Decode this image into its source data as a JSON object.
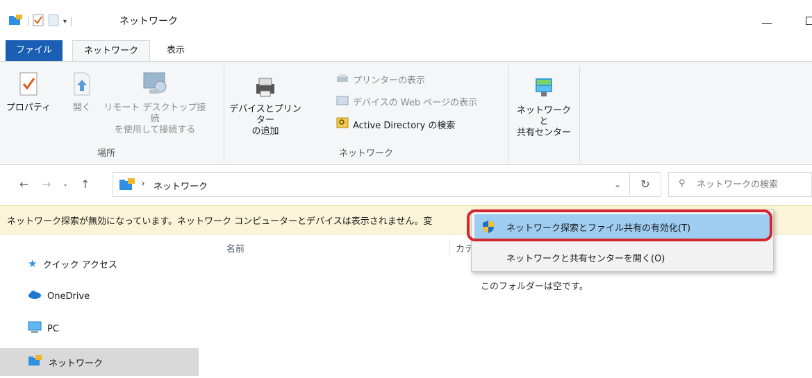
{
  "window": {
    "title": "ネットワーク"
  },
  "ribbon_tabs": {
    "file": "ファイル",
    "network": "ネットワーク",
    "view": "表示"
  },
  "ribbon": {
    "location_group": {
      "label": "場所",
      "properties": "プロパティ",
      "open": "開く",
      "remote_desktop_line1": "リモート デスクトップ接続",
      "remote_desktop_line2": "を使用して接続する"
    },
    "network_group": {
      "label": "ネットワーク",
      "add_devices_line1": "デバイスとプリンター",
      "add_devices_line2": "の追加",
      "show_printers": "プリンターの表示",
      "show_device_webpage": "デバイスの Web ページの表示",
      "search_ad": "Active Directory の検索"
    },
    "sharing_center_line1": "ネットワークと",
    "sharing_center_line2": "共有センター"
  },
  "address": {
    "crumb": "ネットワーク",
    "search_placeholder": "ネットワークの検索"
  },
  "infobar": {
    "text": "ネットワーク探索が無効になっています。ネットワーク コンピューターとデバイスは表示されません。変"
  },
  "sidebar": {
    "items": [
      {
        "label": "クイック アクセス"
      },
      {
        "label": "OneDrive"
      },
      {
        "label": "PC"
      },
      {
        "label": "ネットワーク"
      }
    ]
  },
  "content": {
    "col_name": "名前",
    "col_category": "カテ",
    "empty_message": "このフォルダーは空です。"
  },
  "context_menu": {
    "enable_discovery": "ネットワーク探索とファイル共有の有効化(T)",
    "open_sharing_center": "ネットワークと共有センターを開く(O)"
  },
  "colors": {
    "file_tab": "#1a5fb4",
    "infobar": "#fbf4d8",
    "menu_highlight": "#9fcdf2",
    "annotation_ring": "#d3262e"
  }
}
